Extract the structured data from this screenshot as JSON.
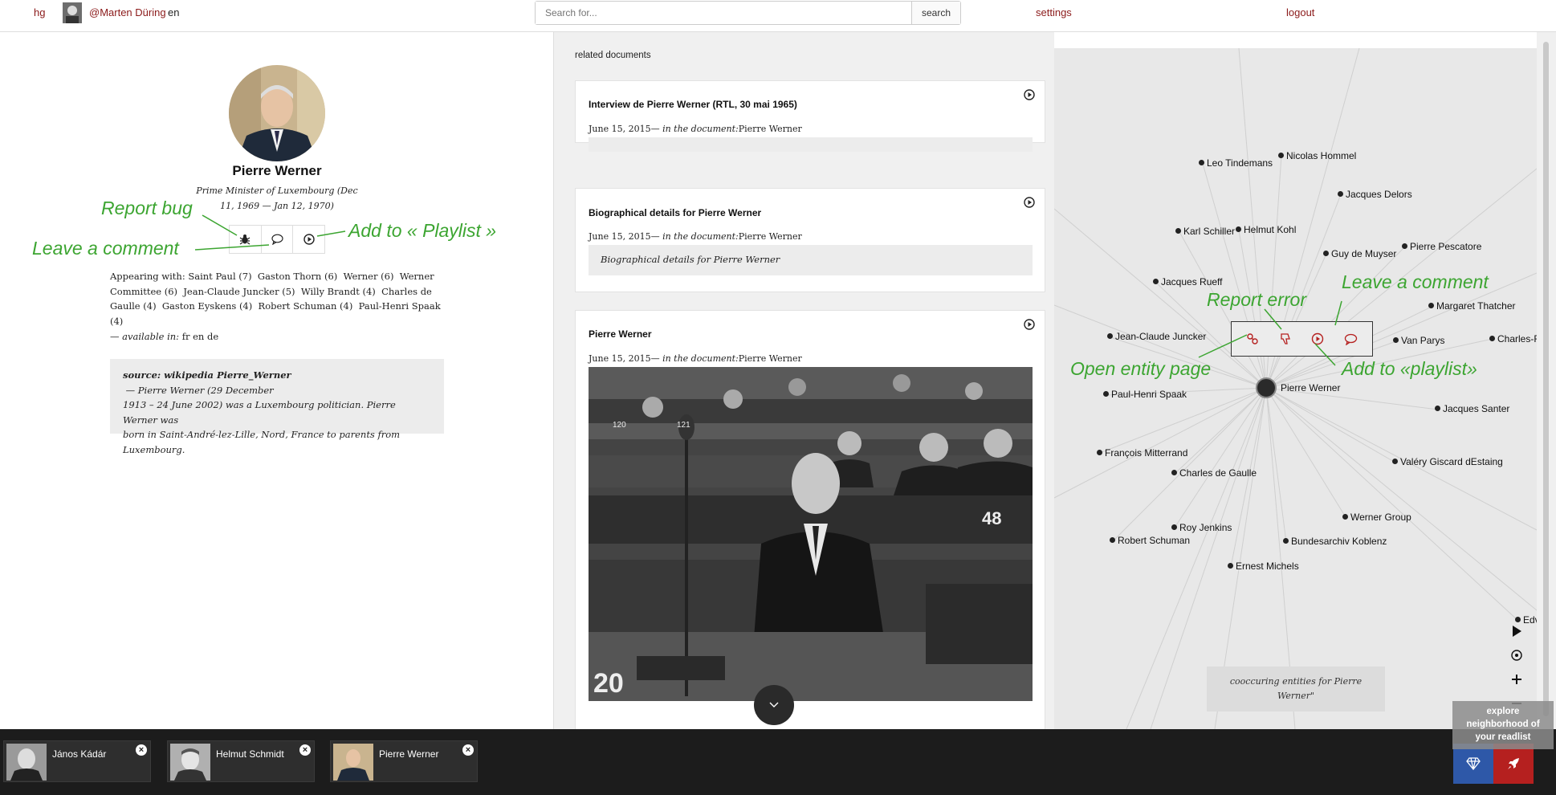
{
  "topbar": {
    "home_link": "hg",
    "user_name": "@Marten Düring",
    "language": "en",
    "search_placeholder": "Search for...",
    "search_button": "search",
    "settings_link": "settings",
    "logout_link": "logout"
  },
  "profile": {
    "name": "Pierre Werner",
    "role_line1": "Prime Minister of Luxembourg (Dec",
    "role_line2": "11, 1969 — Jan 12, 1970)",
    "appearing": [
      "Appearing with: Saint Paul (7)  Gaston Thorn (6)  Werner (6)  Werner",
      "Committee (6)  Jean-Claude Juncker (5)  Willy Brandt (4)  Charles de",
      "Gaulle (4)  Gaston Eyskens (4)  Robert Schuman (4)  Paul-Henri Spaak",
      "(4)"
    ],
    "available_prefix": "— available in:",
    "available_langs": " fr en de",
    "source_bold": "source: wikipedia Pierre_Werner",
    "source_lines": [
      " — Pierre Werner (29 December",
      "1913 – 24 June 2002) was a Luxembourg politician. Pierre Werner was",
      "born in Saint-André-lez-Lille, Nord, France to parents from",
      "Luxembourg."
    ]
  },
  "annotations": {
    "report_bug": "Report bug",
    "leave_comment": "Leave a comment",
    "add_playlist": "Add to « Playlist »",
    "report_error": "Report error",
    "leave_comment_2": "Leave a comment",
    "open_entity": "Open entity page",
    "add_playlist_2": "Add to «playlist»"
  },
  "related": {
    "heading": "related documents",
    "docs": [
      {
        "title": "Interview de Pierre Werner (RTL, 30 mai 1965)",
        "date": "June 15, 2015",
        "in_doc": "— in the document:",
        "doc_name": "Pierre Werner",
        "excerpt": ""
      },
      {
        "title": "Biographical details for Pierre Werner",
        "date": "June 15, 2015",
        "in_doc": "— in the document:",
        "doc_name": "Pierre Werner",
        "excerpt": "Biographical details for Pierre Werner"
      },
      {
        "title": "Pierre Werner",
        "date": "June 15, 2015",
        "in_doc": "— in the document:",
        "doc_name": "Pierre Werner",
        "excerpt": ""
      }
    ]
  },
  "graph": {
    "center": "Pierre Werner",
    "nodes": [
      "Leo Tindemans",
      "Nicolas Hommel",
      "Jacques Delors",
      "Karl Schiller",
      "Helmut Kohl",
      "Guy de Muyser",
      "Pierre Pescatore",
      "Jacques Rueff",
      "Margaret Thatcher",
      "Jean-Claude Juncker",
      "Van Parys",
      "Charles-F",
      "Paul-Henri Spaak",
      "Jacques Santer",
      "François Mitterrand",
      "Charles de Gaulle",
      "Valéry Giscard dEstaing",
      "Roy Jenkins",
      "Werner Group",
      "Robert Schuman",
      "Bundesarchiv Koblenz",
      "Ernest Michels",
      "Edv"
    ],
    "caption": "cooccuring entities for Pierre Werner\""
  },
  "explore": {
    "tooltip_lines": [
      "explore",
      "neighborhood of",
      "your readlist"
    ]
  },
  "tray": {
    "items": [
      "János Kádár",
      "Helmut Schmidt",
      "Pierre Werner"
    ]
  },
  "colors": {
    "accent": "#8b1a1a",
    "annotation": "#3ca531",
    "tray": "#1c1c1c",
    "diamond_btn": "#2e58a8",
    "rocket_btn": "#b5201f"
  }
}
